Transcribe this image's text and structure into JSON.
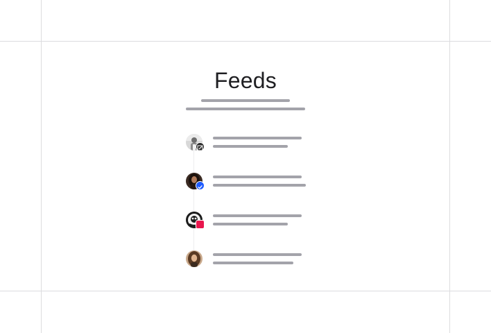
{
  "page": {
    "title": "Feeds"
  },
  "feeds": [
    {
      "avatar_icon": "avatar-bw-man-icon",
      "badge_icon": "edit-pencil-icon",
      "badge_color": "#2b2b2b",
      "line_a": 128,
      "line_b": 108
    },
    {
      "avatar_icon": "avatar-woman-dark-hair-icon",
      "badge_icon": "verified-check-icon",
      "badge_color": "#1f5cff",
      "line_a": 128,
      "line_b": 134
    },
    {
      "avatar_icon": "avatar-illustrated-logo-icon",
      "badge_icon": "pink-heart-tag-icon",
      "badge_color": "#e8164d",
      "line_a": 128,
      "line_b": 108
    },
    {
      "avatar_icon": "avatar-woman-brown-hair-icon",
      "badge_icon": "",
      "badge_color": "",
      "line_a": 128,
      "line_b": 116
    }
  ],
  "colors": {
    "skeleton": "#a3a3aa",
    "guide": "#dcdcdf",
    "title": "#1f1f22"
  }
}
